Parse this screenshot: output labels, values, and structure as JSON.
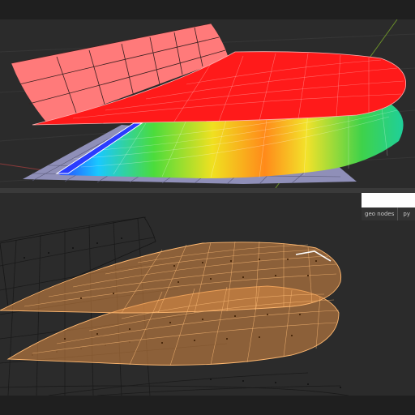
{
  "panel": {
    "tabs": [
      {
        "label": "geo nodes"
      },
      {
        "label": "py"
      }
    ]
  },
  "colors": {
    "background": "#2b2b2b",
    "band": "#1f1f1f",
    "red_surface": "#ff1a1a",
    "pink_surface": "#ff7a7a",
    "lavender_grid": "#8f8fb8",
    "orange_selection": "#e8964a",
    "green_axis": "#6b8f2a",
    "red_axis": "#8a3a3a"
  },
  "icons": [
    "white-panel-header"
  ]
}
